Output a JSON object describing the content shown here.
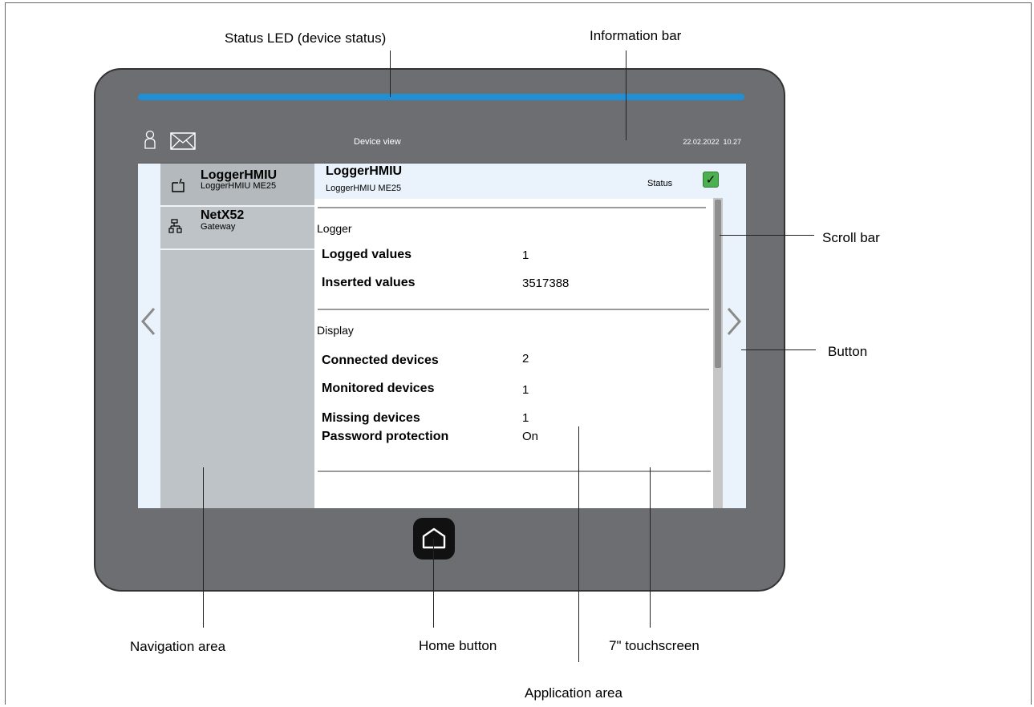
{
  "callouts": {
    "status_led": "Status LED (device status)",
    "information_bar": "Information bar",
    "scroll_bar": "Scroll bar",
    "button": "Button",
    "navigation_area": "Navigation area",
    "home_button": "Home button",
    "touchscreen": "7\" touchscreen",
    "application_area": "Application area"
  },
  "info_bar": {
    "title": "Device view",
    "date": "22.02.2022",
    "time": "10.27",
    "icons": [
      "user-icon",
      "envelope-icon"
    ]
  },
  "navigation": {
    "items": [
      {
        "title": "LoggerHMIU",
        "subtitle": "LoggerHMIU ME25",
        "icon": "device-icon",
        "active": true
      },
      {
        "title": "NetX52",
        "subtitle": "Gateway",
        "icon": "network-icon",
        "active": false
      }
    ]
  },
  "application": {
    "header": {
      "title": "LoggerHMIU",
      "subtitle": "LoggerHMIU ME25",
      "status_label": "Status",
      "status_icon": "checkmark-icon",
      "status_color": "#4caf50"
    },
    "sections": [
      {
        "title": "Logger",
        "rows": [
          {
            "label": "Logged values",
            "value": "1"
          },
          {
            "label": "Inserted values",
            "value": "3517388"
          }
        ]
      },
      {
        "title": "Display",
        "rows": [
          {
            "label": "Connected devices",
            "value": "2"
          },
          {
            "label": "Monitored devices",
            "value": "1"
          },
          {
            "label": "Missing devices",
            "value": "1"
          },
          {
            "label": "Password protection",
            "value": "On"
          }
        ]
      }
    ]
  },
  "colors": {
    "led": "#1f8fd6",
    "housing": "#6d6e71",
    "navigation": "#bdc3c6"
  }
}
